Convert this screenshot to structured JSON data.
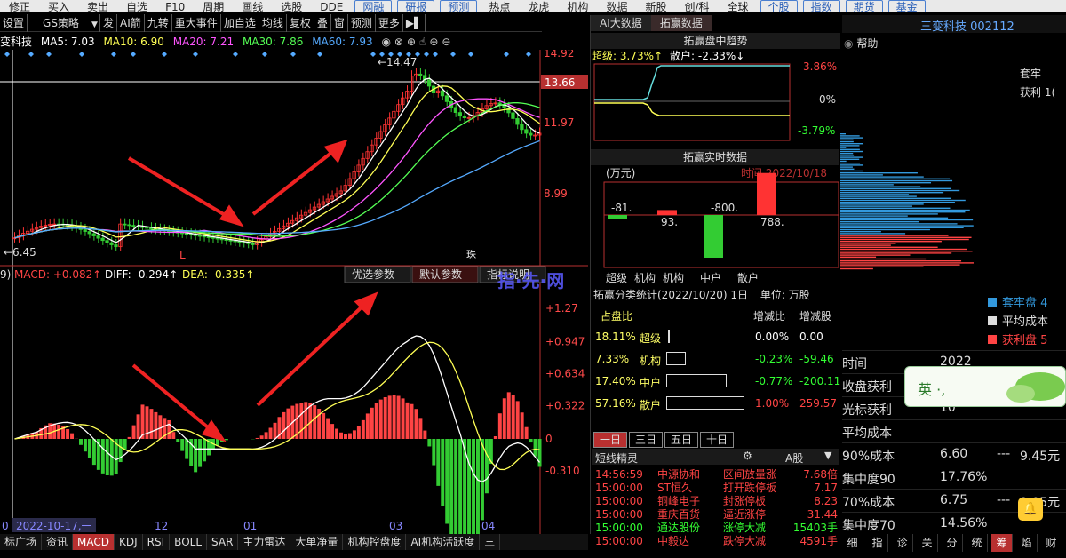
{
  "menubar": {
    "items": [
      "修正",
      "买入",
      "卖出",
      "自选",
      "F10",
      "周期",
      "画线",
      "选股",
      "DDE",
      "网融",
      "研报",
      "预测",
      "热点",
      "龙虎",
      "机构",
      "数据",
      "新股",
      "创/科",
      "全球",
      "个股",
      "指数",
      "期货",
      "基金"
    ]
  },
  "toolbar": {
    "items": [
      "设置",
      "GS策略",
      "发",
      "AI箭",
      "九转",
      "重大事件",
      "加自选",
      "均线",
      "复权",
      "叠",
      "窗",
      "预测",
      "更多"
    ],
    "strategy_dropdown_arrow": "▼"
  },
  "ma_bar": {
    "stock": "变科技",
    "ma5": "MA5: 7.03",
    "ma10": "MA10: 6.90",
    "ma20": "MA20: 7.21",
    "ma30": "MA30: 7.86",
    "ma60": "MA60: 7.93",
    "colors": {
      "ma5": "#ffffff",
      "ma10": "#ffff55",
      "ma20": "#ff55ff",
      "ma30": "#55ff55",
      "ma60": "#55aaff"
    }
  },
  "kline": {
    "axis_labels": [
      "14.92",
      "11.97",
      "8.99"
    ],
    "current_price": "13.66",
    "high_label": "14.47",
    "low_label": "6.45",
    "l_marker": "L",
    "ex_marker": "珠"
  },
  "macd": {
    "header_left": "9)",
    "macd_label": "MACD: +0.082↑",
    "diff_label": "DIFF: -0.294↑",
    "dea_label": "DEA: -0.335↑",
    "buttons": [
      "优选参数",
      "默认参数",
      "指标说明"
    ],
    "axis_labels": [
      "+1.27",
      "+0.947",
      "+0.634",
      "+0.322",
      "0",
      "-0.310"
    ],
    "date_tag": "2022-10-17,一",
    "x_labels": [
      "0",
      "12",
      "01",
      "03",
      "04"
    ]
  },
  "bottom_tabs": [
    "标广场",
    "资讯",
    "MACD",
    "KDJ",
    "RSI",
    "BOLL",
    "SAR",
    "主力雷达",
    "大单净量",
    "机构控盘度",
    "AI机构活跃度",
    "三"
  ],
  "bottom_active": "MACD",
  "ai_tabs": [
    "AI大数据",
    "拓赢数据"
  ],
  "trend": {
    "title": "拓赢盘中趋势",
    "super_label": "超级: 3.73%↑",
    "retail_label": "散户: -2.33%↓",
    "axis": [
      "3.86%",
      "0%",
      "-3.79%"
    ]
  },
  "realtime": {
    "title": "拓赢实时数据",
    "unit": "(万元)",
    "time": "时间 2022/10/18",
    "bars": [
      {
        "cat": "超级",
        "label": "-81.",
        "value": -81,
        "color": "#33cc33"
      },
      {
        "cat": "机构",
        "label": "93.",
        "value": 93,
        "color": "#ff3333"
      },
      {
        "cat": "中户",
        "label": "-800.",
        "value": -800,
        "color": "#33cc33"
      },
      {
        "cat": "散户",
        "label": "788.",
        "value": 788,
        "color": "#ff3333"
      }
    ],
    "categories_text": [
      "超级",
      "机构",
      "机构",
      "中户",
      "散户"
    ]
  },
  "stats": {
    "header": "拓赢分类统计(2022/10/20) 1日",
    "unit": "单位: 万股",
    "col1": "占盘比",
    "col2": "增减比",
    "col3": "增减股",
    "rows": [
      {
        "pct": "18.11%",
        "name": "超级",
        "chg": "0.00%",
        "amt": "0.00",
        "color": "#ffff66",
        "chgcolor": "#ffffff"
      },
      {
        "pct": "7.33%",
        "name": "机构",
        "chg": "-0.23%",
        "amt": "-59.46",
        "color": "#ffff66",
        "chgcolor": "#33ff33"
      },
      {
        "pct": "17.40%",
        "name": "中户",
        "chg": "-0.77%",
        "amt": "-200.11",
        "color": "#ffff66",
        "chgcolor": "#33ff33"
      },
      {
        "pct": "57.16%",
        "name": "散户",
        "chg": "1.00%",
        "amt": "259.57",
        "color": "#ffff66",
        "chgcolor": "#ff4444"
      }
    ]
  },
  "period_tabs": [
    "一日",
    "三日",
    "五日",
    "十日"
  ],
  "news": {
    "title": "短线精灵",
    "market": "A股",
    "rows": [
      {
        "time": "14:56:59",
        "name": "中源协和",
        "event": "区间放量涨",
        "val": "7.68倍",
        "color": "#ff4444"
      },
      {
        "time": "15:00:00",
        "name": "ST恒久",
        "event": "打开跌停板",
        "val": "7.17",
        "color": "#ff4444"
      },
      {
        "time": "15:00:00",
        "name": "铜峰电子",
        "event": "封涨停板",
        "val": "8.23",
        "color": "#ff4444"
      },
      {
        "time": "15:00:00",
        "name": "重庆百货",
        "event": "逼近涨停",
        "val": "31.44",
        "color": "#ff4444"
      },
      {
        "time": "15:00:00",
        "name": "通达股份",
        "event": "涨停大减",
        "val": "15403手",
        "color": "#33ff33"
      },
      {
        "time": "15:00:00",
        "name": "中毅达",
        "event": "跌停大减",
        "val": "4591手",
        "color": "#ff4444"
      }
    ]
  },
  "right": {
    "stock_title": "三变科技 002112",
    "help": "帮助",
    "tao_label": "套牢",
    "profit_label": "获利 1(",
    "legend": [
      {
        "label": "套牢盘 4",
        "color": "#3399dd"
      },
      {
        "label": "平均成本",
        "color": "#dddddd"
      },
      {
        "label": "获利盘 5",
        "color": "#ff4444"
      }
    ],
    "info_rows": [
      {
        "k": "时间",
        "v": "2022",
        "v2": ""
      },
      {
        "k": "收盘获利",
        "v": "8",
        "v2": ""
      },
      {
        "k": "光标获利",
        "v": "10",
        "v2": ""
      },
      {
        "k": "平均成本",
        "v": "",
        "v2": ""
      },
      {
        "k": "90%成本",
        "v": "6.60",
        "dash": "---",
        "v2": "9.45元"
      },
      {
        "k": "集中度90",
        "v": "17.76%",
        "dash": "",
        "v2": ""
      },
      {
        "k": "70%成本",
        "v": "6.75",
        "dash": "---",
        "v2": "9.05元"
      },
      {
        "k": "集中度70",
        "v": "14.56%",
        "dash": "",
        "v2": ""
      }
    ],
    "bottom_tabs": [
      "细",
      "指",
      "诊",
      "关",
      "分",
      "统",
      "筹",
      "焰",
      "财"
    ],
    "bottom_active": "筹"
  },
  "ad": {
    "text": "英 ·, ",
    "watermark": "指·先·网"
  }
}
